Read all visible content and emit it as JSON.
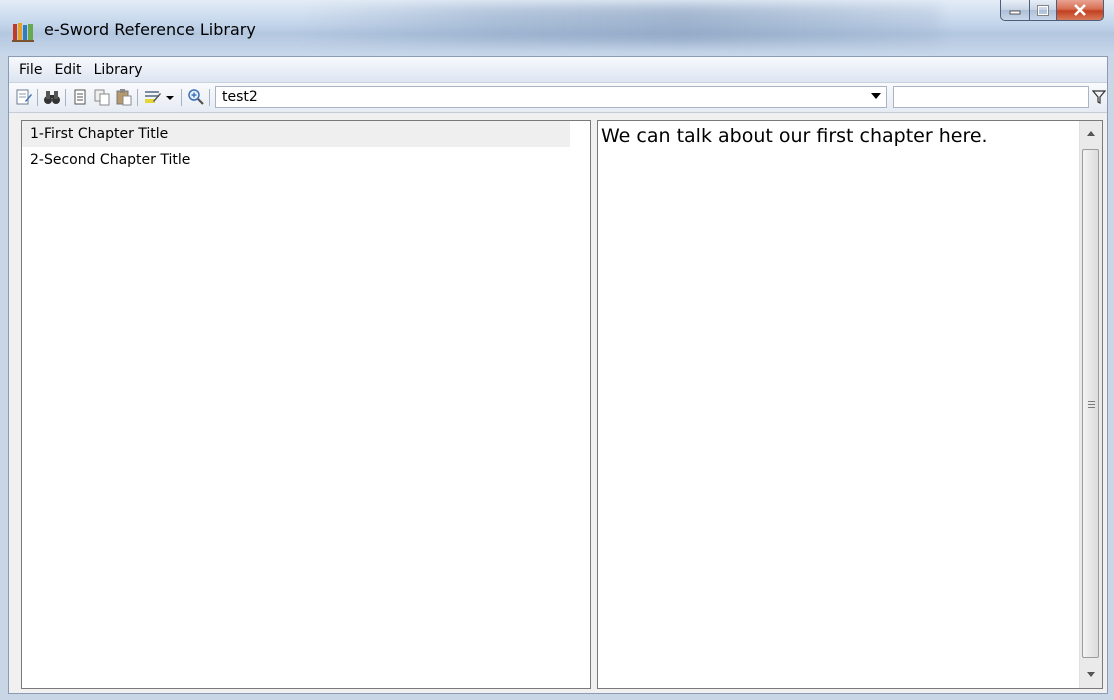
{
  "window": {
    "title": "e-Sword Reference Library",
    "icon": "books-icon"
  },
  "menu": {
    "items": [
      "File",
      "Edit",
      "Library"
    ]
  },
  "toolbar": {
    "icons": [
      "edit-page-icon",
      "binoculars-icon",
      "document-icon",
      "copy-icon",
      "paste-icon",
      "highlight-dropdown-icon",
      "zoom-icon"
    ],
    "combo_value": "test2",
    "filter_value": "",
    "filter_icon": "funnel-icon"
  },
  "chapters": [
    {
      "label": "1-First Chapter Title",
      "selected": true
    },
    {
      "label": "2-Second Chapter Title",
      "selected": false
    }
  ],
  "content": {
    "text": "We can talk about our first chapter here."
  },
  "colors": {
    "titlebar": "#c2d4ea",
    "close_button": "#c2401f",
    "selection": "#efefef"
  }
}
